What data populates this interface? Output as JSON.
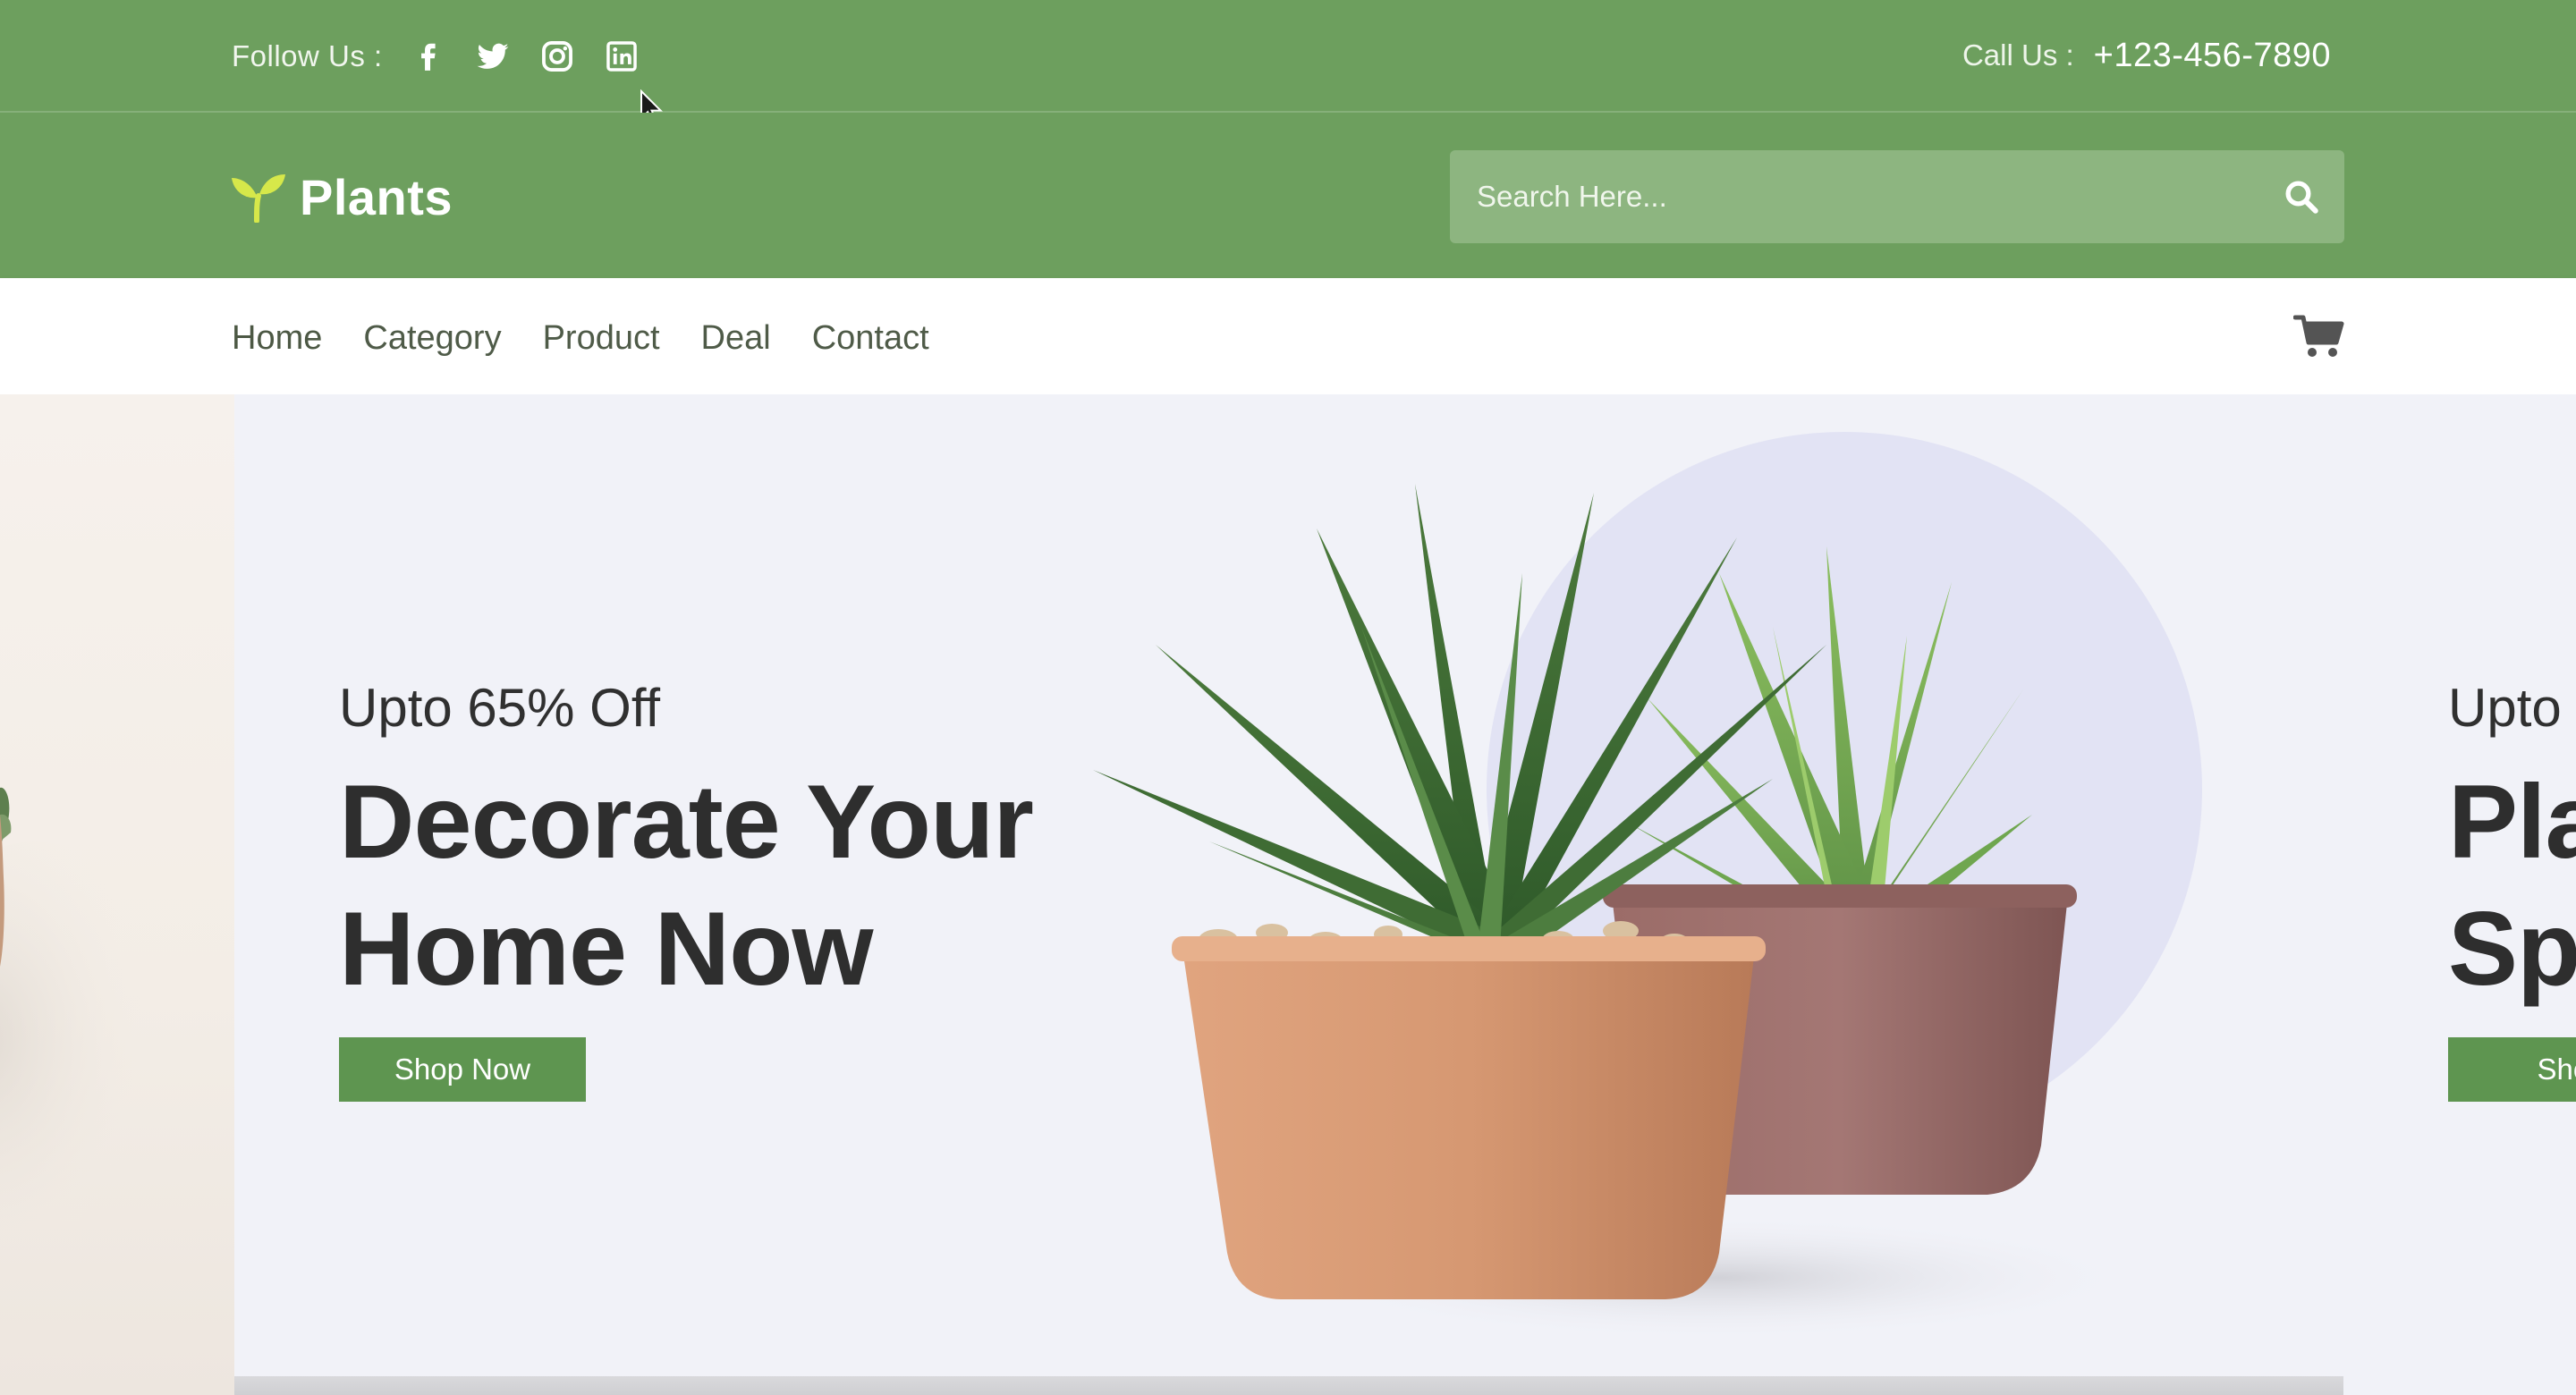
{
  "topbar": {
    "follow_label": "Follow Us :",
    "social": [
      {
        "name": "facebook-icon"
      },
      {
        "name": "twitter-icon"
      },
      {
        "name": "instagram-icon"
      },
      {
        "name": "linkedin-icon"
      }
    ],
    "call_label": "Call Us :",
    "phone": "+123-456-7890"
  },
  "header": {
    "logo_text": "Plants",
    "search": {
      "placeholder": "Search Here..."
    }
  },
  "nav": {
    "items": [
      "Home",
      "Category",
      "Product",
      "Deal",
      "Contact"
    ]
  },
  "hero": {
    "slide": {
      "discount": "Upto 65% Off",
      "headline_line1": "Decorate Your",
      "headline_line2": "Home Now",
      "button": "Shop Now"
    },
    "next_slide": {
      "discount": "Upto",
      "headline_line1": "Pla",
      "headline_line2": "Sp",
      "button": "Shop"
    }
  },
  "colors": {
    "brand_green": "#6d9f5e",
    "button_green": "#5e9550",
    "search_bg": "#8db580",
    "heading_text": "#2e2e2e"
  }
}
